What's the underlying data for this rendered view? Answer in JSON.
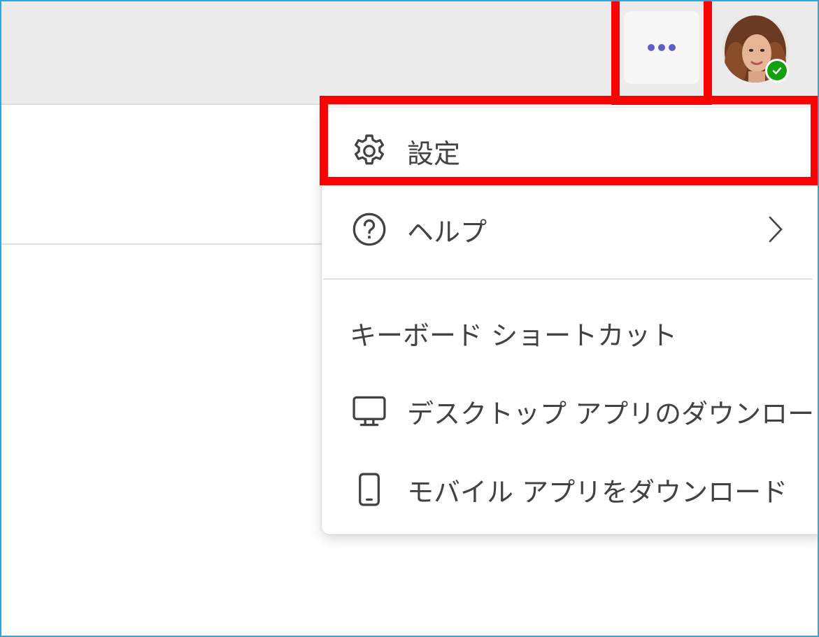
{
  "header": {
    "more_icon": "more-horizontal-icon",
    "avatar_status_icon": "available-check-icon",
    "accent_color": "#5b5fc7",
    "status_color": "#13a10e"
  },
  "menu": {
    "items": [
      {
        "label": "設定",
        "icon": "settings-icon"
      },
      {
        "label": "ヘルプ",
        "icon": "help-icon",
        "submenu_icon": "chevron-right-icon"
      },
      {
        "label": "キーボード ショートカット"
      },
      {
        "label": "デスクトップ アプリのダウンロード",
        "icon": "desktop-icon"
      },
      {
        "label": "モバイル アプリをダウンロード",
        "icon": "mobile-icon"
      }
    ]
  },
  "annotation_color": "#ff0000"
}
